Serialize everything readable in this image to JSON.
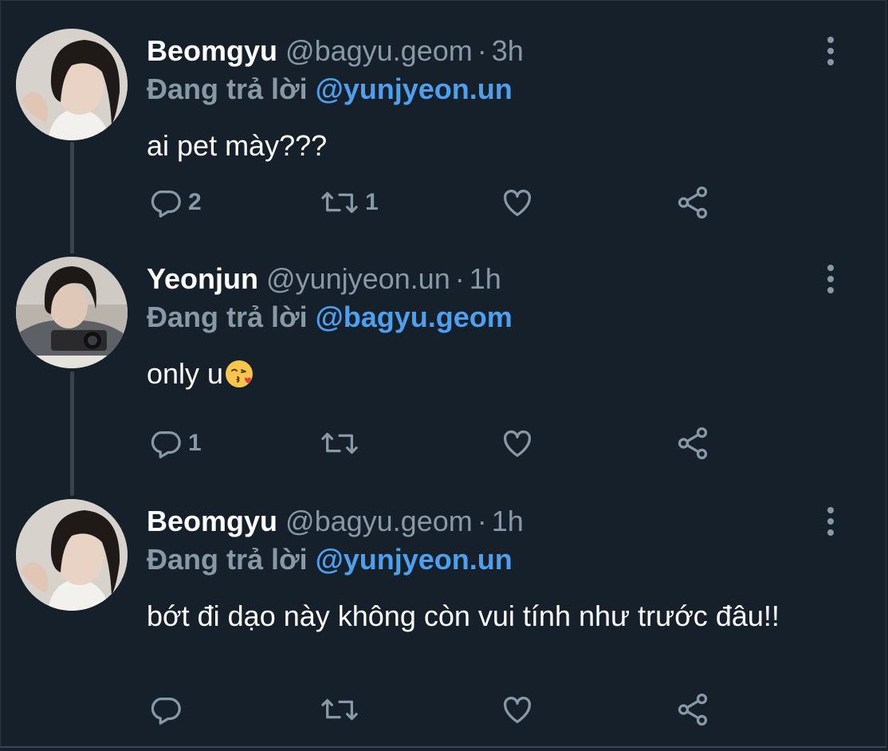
{
  "thread": [
    {
      "name": "Beomgyu",
      "handle": "@bagyu.geom",
      "separator": "·",
      "time": "3h",
      "reply_prefix": "Đang trả lời",
      "reply_to": "@yunjyeon.un",
      "text": "ai pet mày???",
      "reply_count": "2",
      "retweet_count": "1",
      "like_count": "",
      "icons": [
        "reply-icon",
        "retweet-icon",
        "like-icon",
        "share-icon",
        "more-icon"
      ]
    },
    {
      "name": "Yeonjun",
      "handle": "@yunjyeon.un",
      "separator": "·",
      "time": "1h",
      "reply_prefix": "Đang trả lời",
      "reply_to": "@bagyu.geom",
      "text": "only u",
      "emoji": "kissing-face-emoji",
      "reply_count": "1",
      "retweet_count": "",
      "like_count": "",
      "icons": [
        "reply-icon",
        "retweet-icon",
        "like-icon",
        "share-icon",
        "more-icon"
      ]
    },
    {
      "name": "Beomgyu",
      "handle": "@bagyu.geom",
      "separator": "·",
      "time": "1h",
      "reply_prefix": "Đang trả lời",
      "reply_to": "@yunjyeon.un",
      "text": "bớt đi dạo này không còn vui tính như trước đâu!!",
      "reply_count": "",
      "retweet_count": "",
      "like_count": "",
      "icons": [
        "reply-icon",
        "retweet-icon",
        "like-icon",
        "share-icon",
        "more-icon"
      ]
    }
  ],
  "colors": {
    "background": "#15202b",
    "text_primary": "#ffffff",
    "text_secondary": "#8899a6",
    "accent_link": "#4f9ff0",
    "thread_line": "#38444d"
  }
}
